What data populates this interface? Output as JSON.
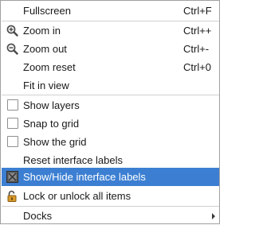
{
  "menu": {
    "items": [
      {
        "label": "Fullscreen",
        "shortcut": "Ctrl+F"
      },
      {
        "label": "Zoom in",
        "shortcut": "Ctrl++",
        "icon": "zoom-in-icon"
      },
      {
        "label": "Zoom out",
        "shortcut": "Ctrl+-",
        "icon": "zoom-out-icon"
      },
      {
        "label": "Zoom reset",
        "shortcut": "Ctrl+0"
      },
      {
        "label": "Fit in view"
      },
      {
        "label": "Show layers",
        "checked": false
      },
      {
        "label": "Snap to grid",
        "checked": false
      },
      {
        "label": "Show the grid",
        "checked": false
      },
      {
        "label": "Reset interface labels"
      },
      {
        "label": "Show/Hide interface labels",
        "highlighted": true,
        "icon": "labels-toggle-icon"
      },
      {
        "label": "Lock or unlock all items",
        "icon": "padlock-icon"
      },
      {
        "label": "Docks",
        "submenu": true
      }
    ]
  },
  "colors": {
    "highlight": "#3c7fd2",
    "highlight_text": "#ffffff",
    "separator": "#d0d0d0",
    "border": "#a0a0a0"
  }
}
